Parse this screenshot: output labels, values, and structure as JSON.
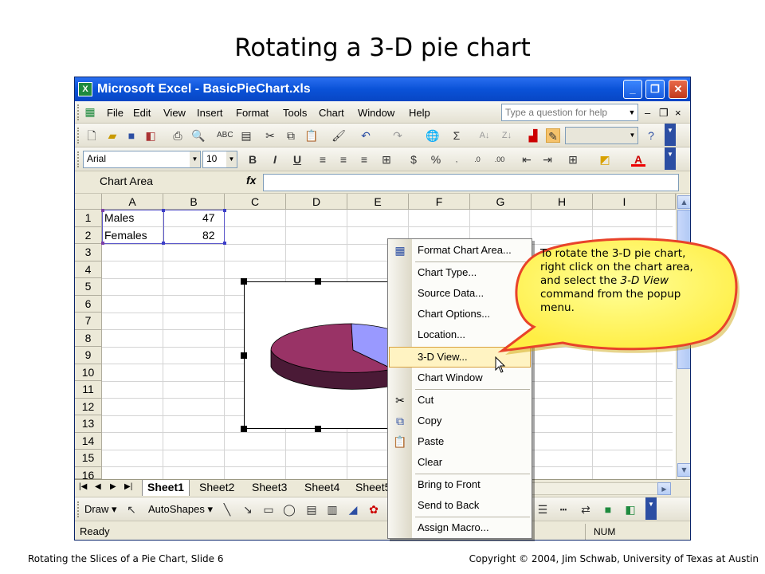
{
  "slide": {
    "title": "Rotating a 3-D pie chart",
    "footer_left": "Rotating the Slices of a Pie Chart, Slide 6",
    "footer_right": "Copyright © 2004, Jim Schwab, University of Texas at Austin"
  },
  "window": {
    "title": "Microsoft Excel - BasicPieChart.xls",
    "controls": {
      "minimize": "_",
      "maximize": "❐",
      "close": "✕"
    }
  },
  "menubar": {
    "items": [
      "File",
      "Edit",
      "View",
      "Insert",
      "Format",
      "Tools",
      "Chart",
      "Window",
      "Help"
    ],
    "ask_placeholder": "Type a question for help"
  },
  "format_toolbar": {
    "font": "Arial",
    "size": "10",
    "bold": "B",
    "italic": "I",
    "underline": "U",
    "currency": "$",
    "percent": "%"
  },
  "formula_bar": {
    "name_box": "Chart Area",
    "fx": "fx"
  },
  "sheet": {
    "columns": [
      "A",
      "B",
      "C",
      "D",
      "E",
      "F",
      "G",
      "H",
      "I"
    ],
    "rows": [
      "1",
      "2",
      "3",
      "4",
      "5",
      "6",
      "7",
      "8",
      "9",
      "10",
      "11",
      "12",
      "13",
      "14",
      "15",
      "16"
    ],
    "cells": {
      "a1": "Males",
      "b1": "47",
      "a2": "Females",
      "b2": "82"
    }
  },
  "tabs": {
    "items": [
      "Sheet1",
      "Sheet2",
      "Sheet3",
      "Sheet4",
      "Sheet5"
    ],
    "active": "Sheet1"
  },
  "drawing_toolbar": {
    "draw": "Draw",
    "autoshapes": "AutoShapes"
  },
  "status": {
    "left": "Ready",
    "num": "NUM"
  },
  "context_menu": {
    "items": [
      {
        "label": "Format Chart Area...",
        "icon": "format-chart-icon"
      },
      {
        "label": "Chart Type..."
      },
      {
        "label": "Source Data..."
      },
      {
        "label": "Chart Options..."
      },
      {
        "label": "Location..."
      },
      {
        "label": "3-D View..."
      },
      {
        "label": "Chart Window"
      },
      {
        "label": "Cut",
        "icon": "scissors-icon"
      },
      {
        "label": "Copy",
        "icon": "copy-icon"
      },
      {
        "label": "Paste",
        "icon": "paste-icon"
      },
      {
        "label": "Clear"
      },
      {
        "label": "Bring to Front"
      },
      {
        "label": "Send to Back"
      },
      {
        "label": "Assign Macro..."
      }
    ],
    "highlighted": "3-D View..."
  },
  "callout": {
    "text_before": "To rotate the 3-D pie chart, right click on the chart area, and select the",
    "em": "3-D View",
    "text_after": "command from the popup menu."
  },
  "colors": {
    "titlebar": "#0a52d8",
    "pie_females": "#993366",
    "pie_males": "#9999ff",
    "callout_fill": "#ffff66",
    "callout_border": "#e8432a",
    "menu_highlight": "#fff3c2"
  }
}
